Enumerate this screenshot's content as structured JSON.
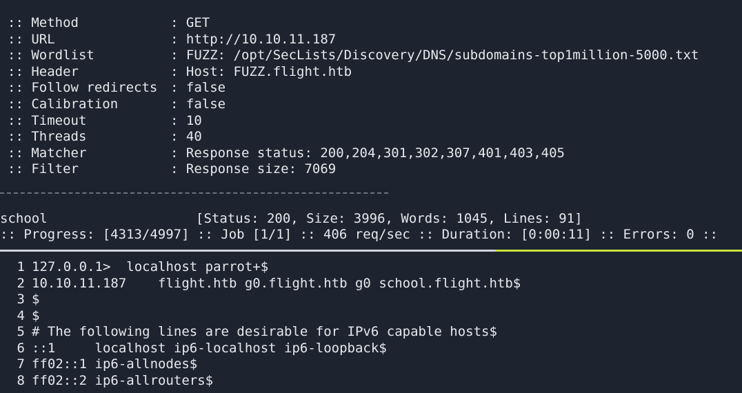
{
  "ffuf": {
    "options": [
      {
        "key": ":: Method",
        "value": ": GET"
      },
      {
        "key": ":: URL",
        "value": ": http://10.10.11.187"
      },
      {
        "key": ":: Wordlist",
        "value": ": FUZZ: /opt/SecLists/Discovery/DNS/subdomains-top1million-5000.txt"
      },
      {
        "key": ":: Header",
        "value": ": Host: FUZZ.flight.htb"
      },
      {
        "key": ":: Follow redirects",
        "value": ": false"
      },
      {
        "key": ":: Calibration",
        "value": ": false"
      },
      {
        "key": ":: Timeout",
        "value": ": 10"
      },
      {
        "key": ":: Threads",
        "value": ": 40"
      },
      {
        "key": ":: Matcher",
        "value": ": Response status: 200,204,301,302,307,401,403,405"
      },
      {
        "key": ":: Filter",
        "value": ": Response size: 7069"
      }
    ],
    "result": {
      "word": "school",
      "details": "[Status: 200, Size: 3996, Words: 1045, Lines: 91]"
    },
    "progress": ":: Progress: [4313/4997] :: Job [1/1] :: 406 req/sec :: Duration: [0:00:11] :: Errors: 0 ::"
  },
  "editor": {
    "lines": [
      {
        "num": "1",
        "text": "127.0.0.1>  localhost parrot+$"
      },
      {
        "num": "2",
        "text": "10.10.11.187    flight.htb g0.flight.htb g0 school.flight.htb$"
      },
      {
        "num": "3",
        "text": "$"
      },
      {
        "num": "4",
        "text": "$"
      },
      {
        "num": "5",
        "text": "# The following lines are desirable for IPv6 capable hosts$"
      },
      {
        "num": "6",
        "text": "::1     localhost ip6-localhost ip6-loopback$"
      },
      {
        "num": "7",
        "text": "ff02::1 ip6-allnodes$"
      },
      {
        "num": "8",
        "text": "ff02::2 ip6-allrouters$"
      }
    ]
  },
  "colors": {
    "background": "#1d2430",
    "text": "#e6e8ec",
    "active_pane_border": "#c7e23a"
  }
}
